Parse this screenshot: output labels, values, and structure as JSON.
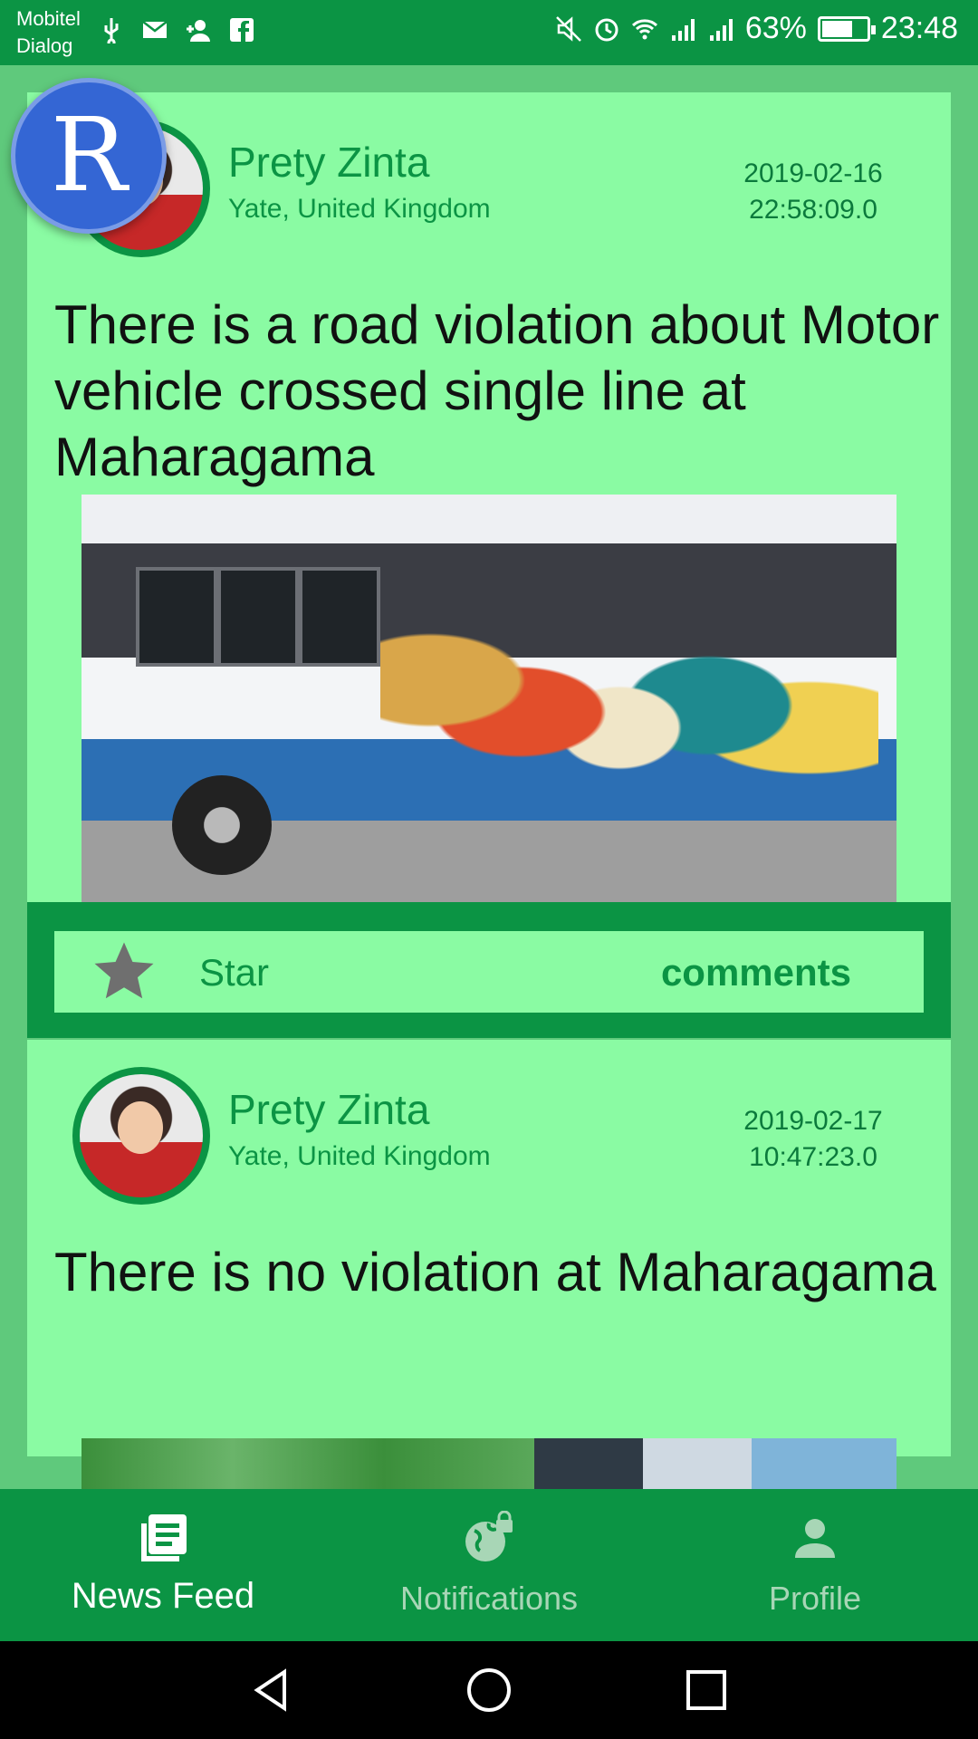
{
  "status_bar": {
    "carrier_line1": "Mobitel",
    "carrier_line2": "Dialog",
    "battery_percent": "63%",
    "time": "23:48",
    "icons": [
      "usb-icon",
      "mail-icon",
      "add-contact-icon",
      "facebook-icon",
      "mute-icon",
      "alarm-icon",
      "wifi-icon",
      "signal-icon",
      "signal-icon",
      "battery-charging-icon"
    ]
  },
  "floating_bubble": {
    "letter": "R"
  },
  "posts": [
    {
      "author": "Prety Zinta",
      "location": "Yate, United Kingdom",
      "date": "2019-02-16",
      "time": "22:58:09.0",
      "text": "There is a road violation about Motor vehicle crossed single line at Maharagama",
      "star_label": "Star",
      "comments_label": "comments"
    },
    {
      "author": "Prety Zinta",
      "location": "Yate, United Kingdom",
      "date": "2019-02-17",
      "time": "10:47:23.0",
      "text": "There is no violation at Maharagama"
    }
  ],
  "bottom_nav": {
    "items": [
      {
        "label": "News Feed",
        "icon": "newspaper-icon",
        "active": true
      },
      {
        "label": "Notifications",
        "icon": "globe-lock-icon",
        "active": false
      },
      {
        "label": "Profile",
        "icon": "person-icon",
        "active": false
      }
    ]
  },
  "system_nav": {
    "icons": [
      "back-icon",
      "home-icon",
      "recents-icon"
    ]
  },
  "colors": {
    "primary": "#0b9444",
    "card": "#8afba3",
    "background": "#5fc97c",
    "r_bubble": "#3466d4"
  }
}
